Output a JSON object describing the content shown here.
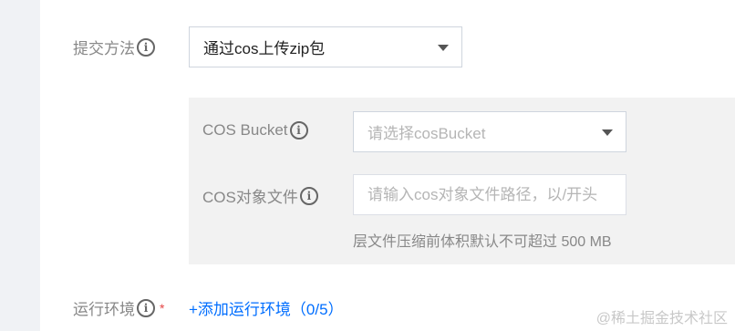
{
  "submit_method": {
    "label": "提交方法",
    "selected": "通过cos上传zip包"
  },
  "cos_bucket": {
    "label": "COS Bucket",
    "placeholder": "请选择cosBucket"
  },
  "cos_file": {
    "label": "COS对象文件",
    "placeholder": "请输入cos对象文件路径，以/开头",
    "hint": "层文件压缩前体积默认不可超过 500 MB"
  },
  "runtime": {
    "label": "运行环境",
    "required_mark": "*",
    "add_link": "+添加运行环境（0/5）"
  },
  "watermark": "@稀土掘金技术社区",
  "icons": {
    "info": "info-icon",
    "dropdown": "caret-down-icon"
  },
  "colors": {
    "accent": "#006eff",
    "required": "#e54545",
    "panel": "#f2f2f2"
  }
}
